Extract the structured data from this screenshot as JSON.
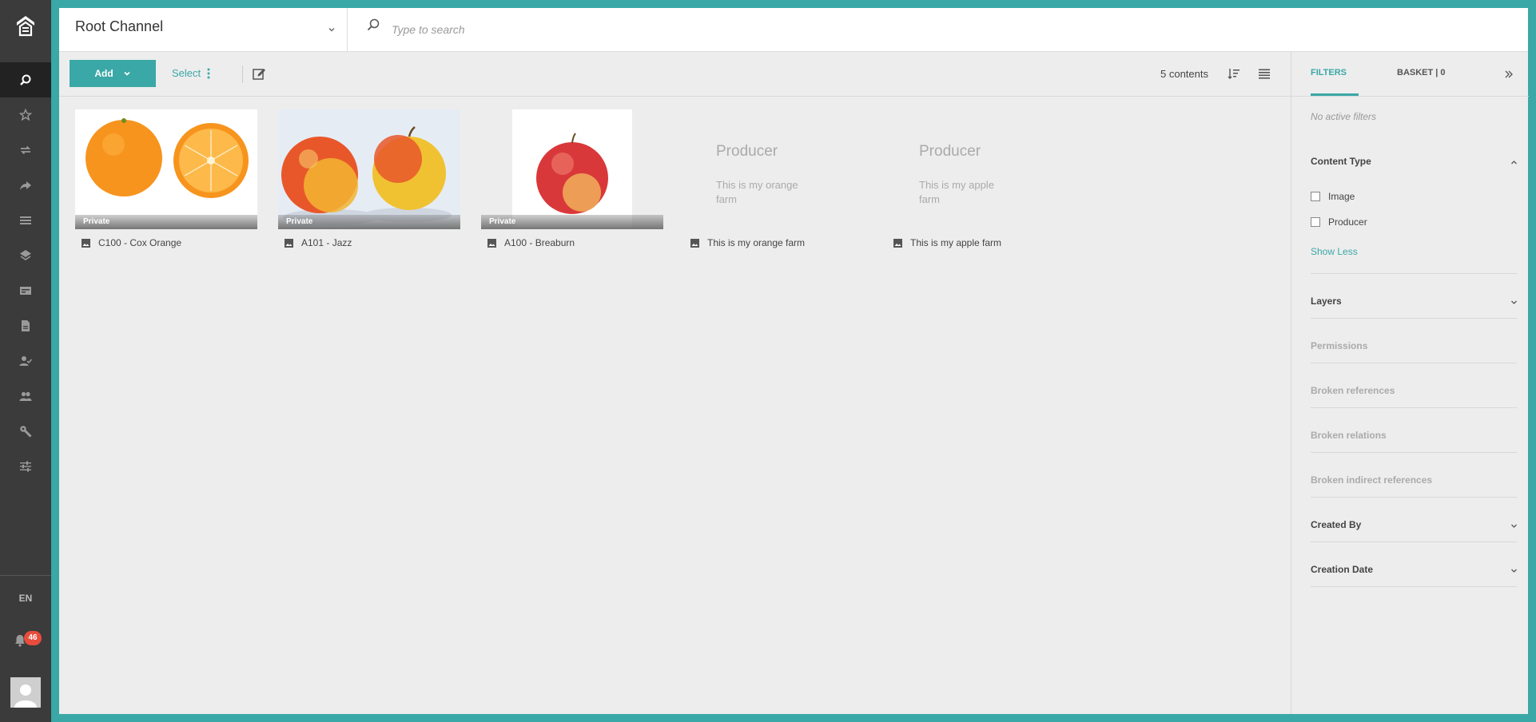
{
  "sidebar": {
    "logo": "studio-logo-icon",
    "items": [
      {
        "name": "search-icon"
      },
      {
        "name": "star-icon"
      },
      {
        "name": "transfer-icon"
      },
      {
        "name": "share-icon"
      },
      {
        "name": "list-icon"
      },
      {
        "name": "layers-icon"
      },
      {
        "name": "card-icon"
      },
      {
        "name": "document-icon"
      },
      {
        "name": "user-check-icon"
      },
      {
        "name": "users-icon"
      },
      {
        "name": "wrench-icon"
      },
      {
        "name": "sliders-icon"
      }
    ],
    "language": "EN",
    "notification_count": "46"
  },
  "topbar": {
    "channel_title": "Root Channel",
    "search_placeholder": "Type to search"
  },
  "toolbar": {
    "add_label": "Add",
    "select_label": "Select",
    "count_label": "5 contents"
  },
  "contents": [
    {
      "type": "image",
      "badge": "Private",
      "caption": "C100 - Cox Orange"
    },
    {
      "type": "image",
      "badge": "Private",
      "caption": "A101 - Jazz"
    },
    {
      "type": "image",
      "badge": "Private",
      "caption": "A100 - Breaburn"
    },
    {
      "type": "producer",
      "title": "Producer",
      "description": "This is my orange farm",
      "caption": "This is my orange farm"
    },
    {
      "type": "producer",
      "title": "Producer",
      "description": "This is my apple farm",
      "caption": "This is my apple farm"
    }
  ],
  "panel": {
    "tab_filters": "FILTERS",
    "tab_basket": "BASKET | 0",
    "no_filters": "No active filters",
    "content_type": {
      "title": "Content Type",
      "options": [
        "Image",
        "Producer"
      ],
      "show_less": "Show Less"
    },
    "sections": [
      "Layers",
      "Permissions",
      "Broken references",
      "Broken relations",
      "Broken indirect references",
      "Created By",
      "Creation Date"
    ]
  },
  "colors": {
    "accent": "#3aa8a6",
    "sidebar_bg": "#3b3b3b",
    "content_bg": "#ededed",
    "badge_red": "#e74c3c"
  }
}
